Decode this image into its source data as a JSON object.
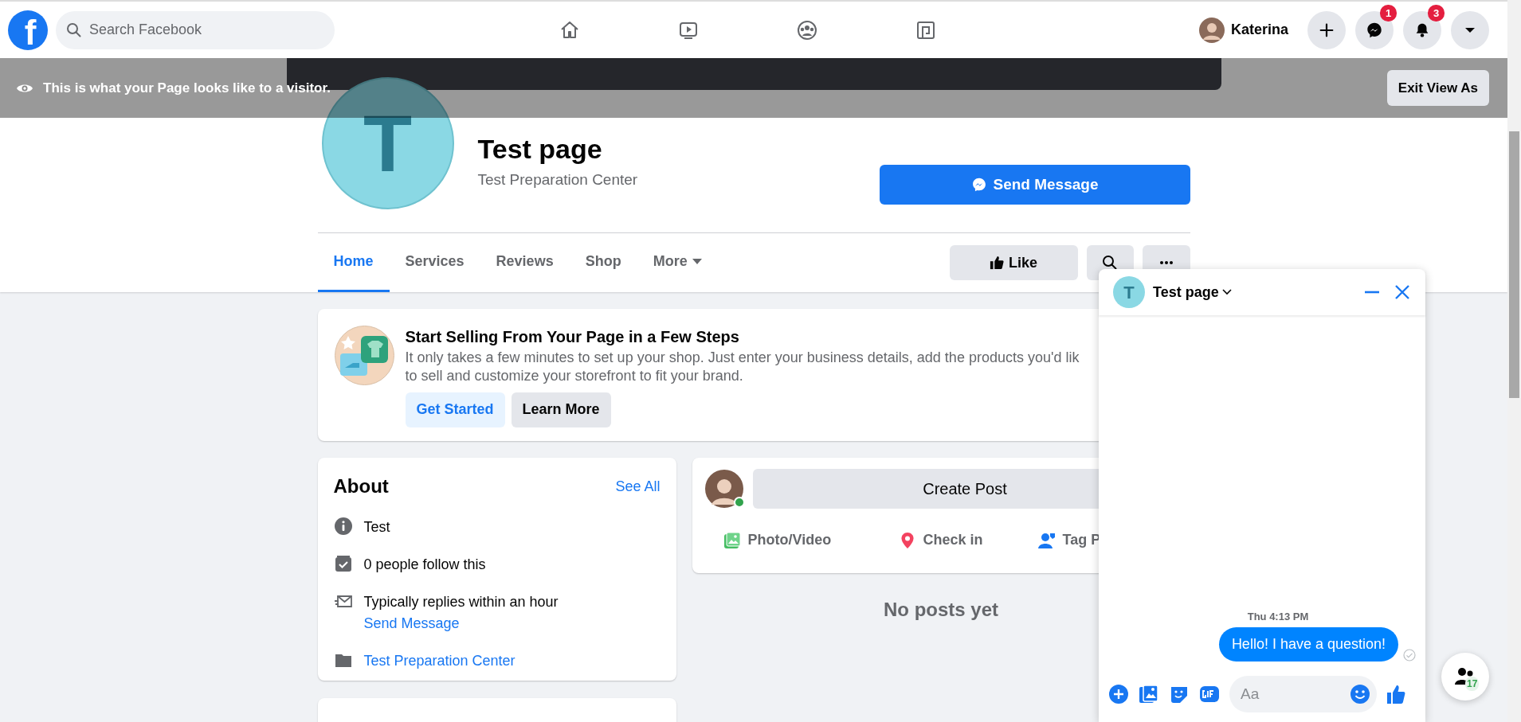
{
  "topbar": {
    "logo": "f",
    "search": {
      "placeholder": "Search Facebook"
    },
    "nav": [
      {
        "kind": "home"
      },
      {
        "kind": "watch"
      },
      {
        "kind": "groups"
      },
      {
        "kind": "gaming"
      }
    ],
    "user": {
      "name": "Katerina"
    },
    "actions": [
      {
        "kind": "create"
      },
      {
        "kind": "messenger",
        "badge": "1"
      },
      {
        "kind": "notifications",
        "badge": "3"
      },
      {
        "kind": "account"
      }
    ]
  },
  "visitor_banner": {
    "text": "This is what your Page looks like to a visitor.",
    "button": "Exit View As"
  },
  "page": {
    "avatar_letter": "T",
    "name": "Test page",
    "category": "Test Preparation Center",
    "send_button": "Send Message"
  },
  "tabs": [
    {
      "label": "Home",
      "selected": true,
      "dropdown": false
    },
    {
      "label": "Services",
      "selected": false,
      "dropdown": false
    },
    {
      "label": "Reviews",
      "selected": false,
      "dropdown": false
    },
    {
      "label": "Shop",
      "selected": false,
      "dropdown": false
    },
    {
      "label": "More",
      "selected": false,
      "dropdown": true
    }
  ],
  "page_actions": [
    {
      "kind": "like",
      "label": "Like"
    },
    {
      "kind": "search"
    },
    {
      "kind": "more"
    }
  ],
  "promo": {
    "title": "Start Selling From Your Page in a Few Steps",
    "lines": [
      "It only takes a few minutes to set up your shop. Just enter your business details, add the products you'd lik",
      "to sell and customize your storefront to fit your brand."
    ],
    "buttons": [
      {
        "label": "Get Started",
        "kind": "primary"
      },
      {
        "label": "Learn More",
        "kind": "secondary"
      }
    ]
  },
  "about": {
    "title": "About",
    "link": "See All",
    "items": [
      {
        "kind": "info",
        "text": "Test"
      },
      {
        "kind": "followers",
        "text": "0 people follow this"
      },
      {
        "kind": "response",
        "text": "Typically replies within an hour",
        "link": "Send Message"
      },
      {
        "kind": "category",
        "link": "Test Preparation Center"
      }
    ]
  },
  "composer": {
    "button": "Create Post",
    "online": true,
    "actions": [
      {
        "kind": "photo",
        "label": "Photo/Video"
      },
      {
        "kind": "checkin",
        "label": "Check in"
      },
      {
        "kind": "tag",
        "label": "Tag P"
      }
    ]
  },
  "feed": {
    "empty_text": "No posts yet"
  },
  "chat": {
    "avatar_letter": "T",
    "title": "Test page",
    "time": "Thu 4:13 PM",
    "messages": [
      {
        "text": "Hello! I have a question!"
      }
    ],
    "input": {
      "placeholder": "Aa"
    }
  },
  "contacts": {
    "count": "17"
  }
}
